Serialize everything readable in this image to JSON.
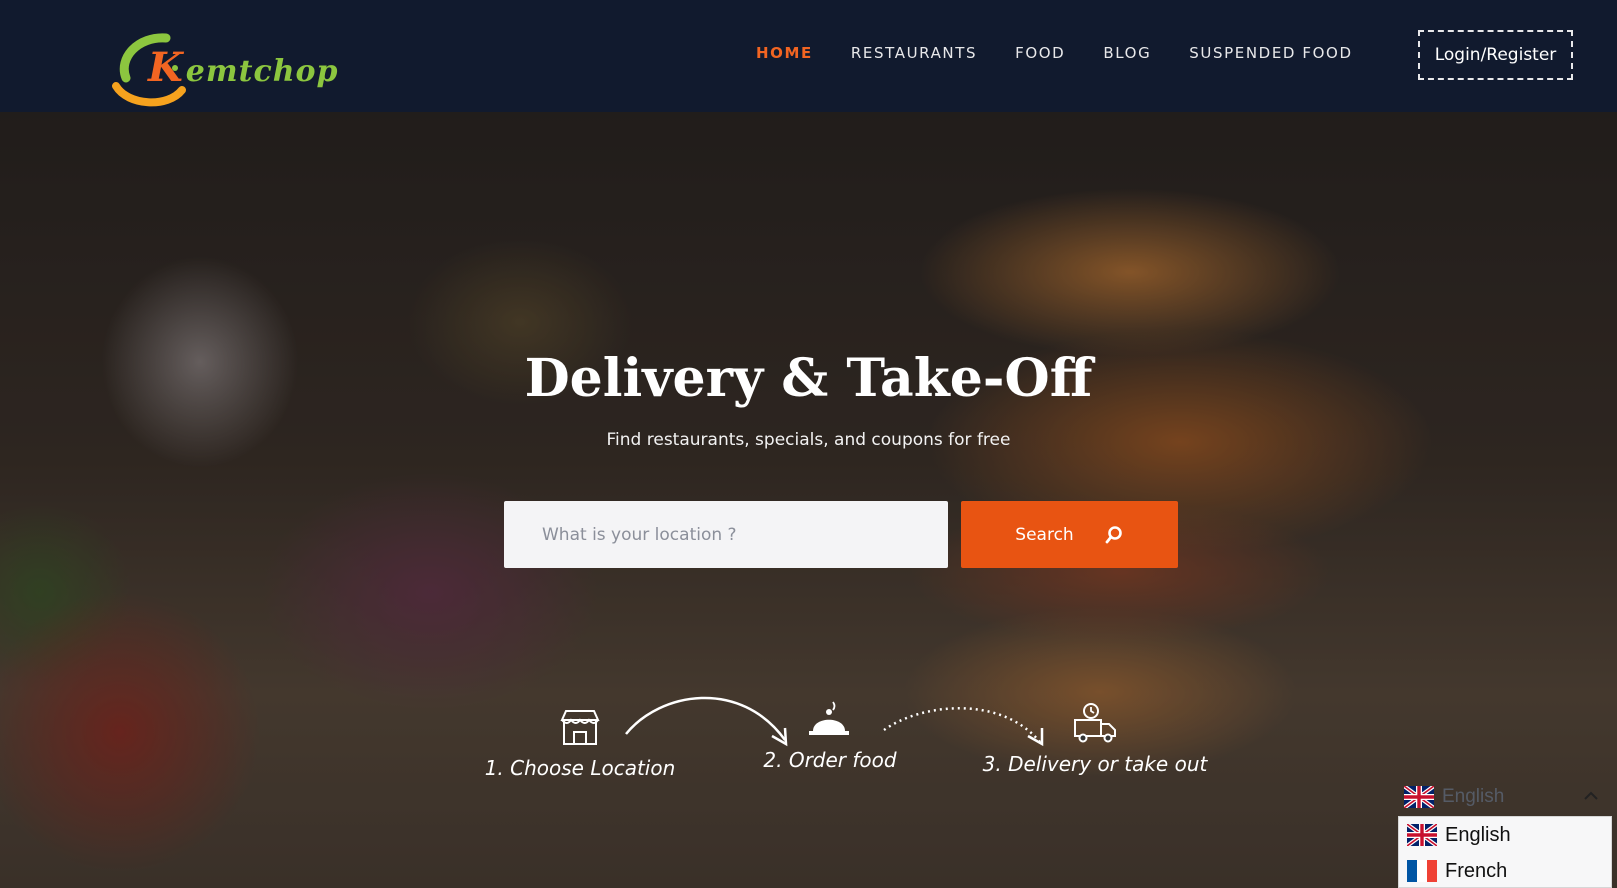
{
  "header": {
    "logo_text": "Kemtchop",
    "nav": [
      {
        "label": "HOME",
        "active": true
      },
      {
        "label": "RESTAURANTS",
        "active": false
      },
      {
        "label": "FOOD",
        "active": false
      },
      {
        "label": "BLOG",
        "active": false
      },
      {
        "label": "SUSPENDED FOOD",
        "active": false
      }
    ],
    "login_label": "Login/Register"
  },
  "hero": {
    "title": "Delivery & Take-Off",
    "subtitle": "Find restaurants, specials, and coupons for free",
    "search": {
      "placeholder": "What is your location ?",
      "button_label": "Search"
    },
    "steps": [
      {
        "label": "1. Choose Location",
        "icon": "store-icon"
      },
      {
        "label": "2. Order food",
        "icon": "cloche-icon"
      },
      {
        "label": "3. Delivery or take out",
        "icon": "delivery-truck-icon"
      }
    ]
  },
  "language": {
    "current": "English",
    "options": [
      {
        "label": "English",
        "flag": "uk-flag-icon"
      },
      {
        "label": "French",
        "flag": "france-flag-icon"
      }
    ]
  },
  "colors": {
    "accent": "#e85412",
    "header_bg": "#111a2e",
    "logo_green": "#8cc63f",
    "logo_orange": "#f26522"
  }
}
